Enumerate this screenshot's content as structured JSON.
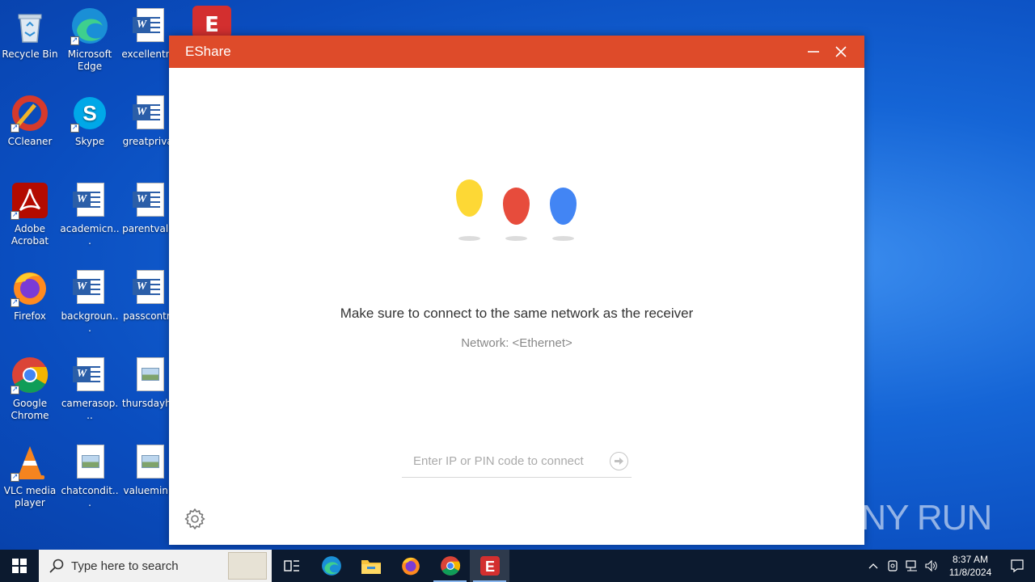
{
  "desktop": {
    "icons": [
      {
        "label": "Recycle Bin"
      },
      {
        "label": "Microsoft Edge"
      },
      {
        "label": "excellentna"
      },
      {
        "label": "CCleaner"
      },
      {
        "label": "Skype"
      },
      {
        "label": "greatprivat"
      },
      {
        "label": "Adobe Acrobat"
      },
      {
        "label": "academicn..."
      },
      {
        "label": "parentvalle"
      },
      {
        "label": "Firefox"
      },
      {
        "label": "backgroun..."
      },
      {
        "label": "passcontro"
      },
      {
        "label": "Google Chrome"
      },
      {
        "label": "camerasop..."
      },
      {
        "label": "thursdayhe"
      },
      {
        "label": "VLC media player"
      },
      {
        "label": "chatcondit..."
      },
      {
        "label": "valueminis"
      }
    ]
  },
  "window": {
    "title": "EShare",
    "headline": "Make sure to connect to the same network as the receiver",
    "network": "Network:  <Ethernet>",
    "connect_placeholder": "Enter IP or PIN code to connect",
    "colors": {
      "titlebar": "#de4b2a",
      "drop_yellow": "#fdd835",
      "drop_red": "#e74c3c",
      "drop_blue": "#4285f4"
    }
  },
  "watermark": "ANY RUN",
  "taskbar": {
    "search_placeholder": "Type here to search",
    "time": "8:37 AM",
    "date": "11/8/2024"
  }
}
